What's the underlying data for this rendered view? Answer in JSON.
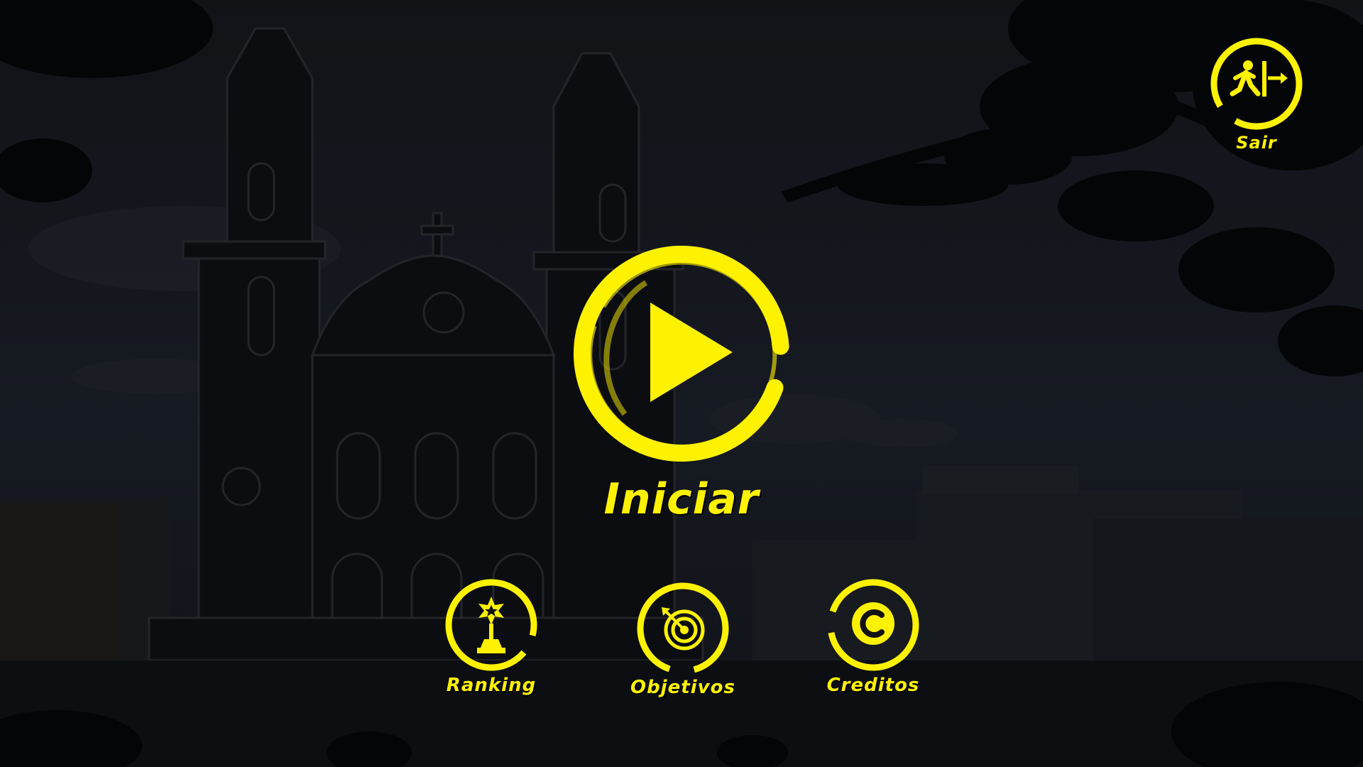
{
  "menu": {
    "play": {
      "label": "Iniciar",
      "icon": "play-icon"
    },
    "ranking": {
      "label": "Ranking",
      "icon": "trophy-icon"
    },
    "objetivos": {
      "label": "Objetivos",
      "icon": "target-icon"
    },
    "creditos": {
      "label": "Creditos",
      "icon": "copyright-icon"
    },
    "sair": {
      "label": "Sair",
      "icon": "exit-running-man-icon"
    }
  },
  "colors": {
    "accent": "#fff200",
    "background_night": "#101319",
    "silhouette": "#050608"
  }
}
